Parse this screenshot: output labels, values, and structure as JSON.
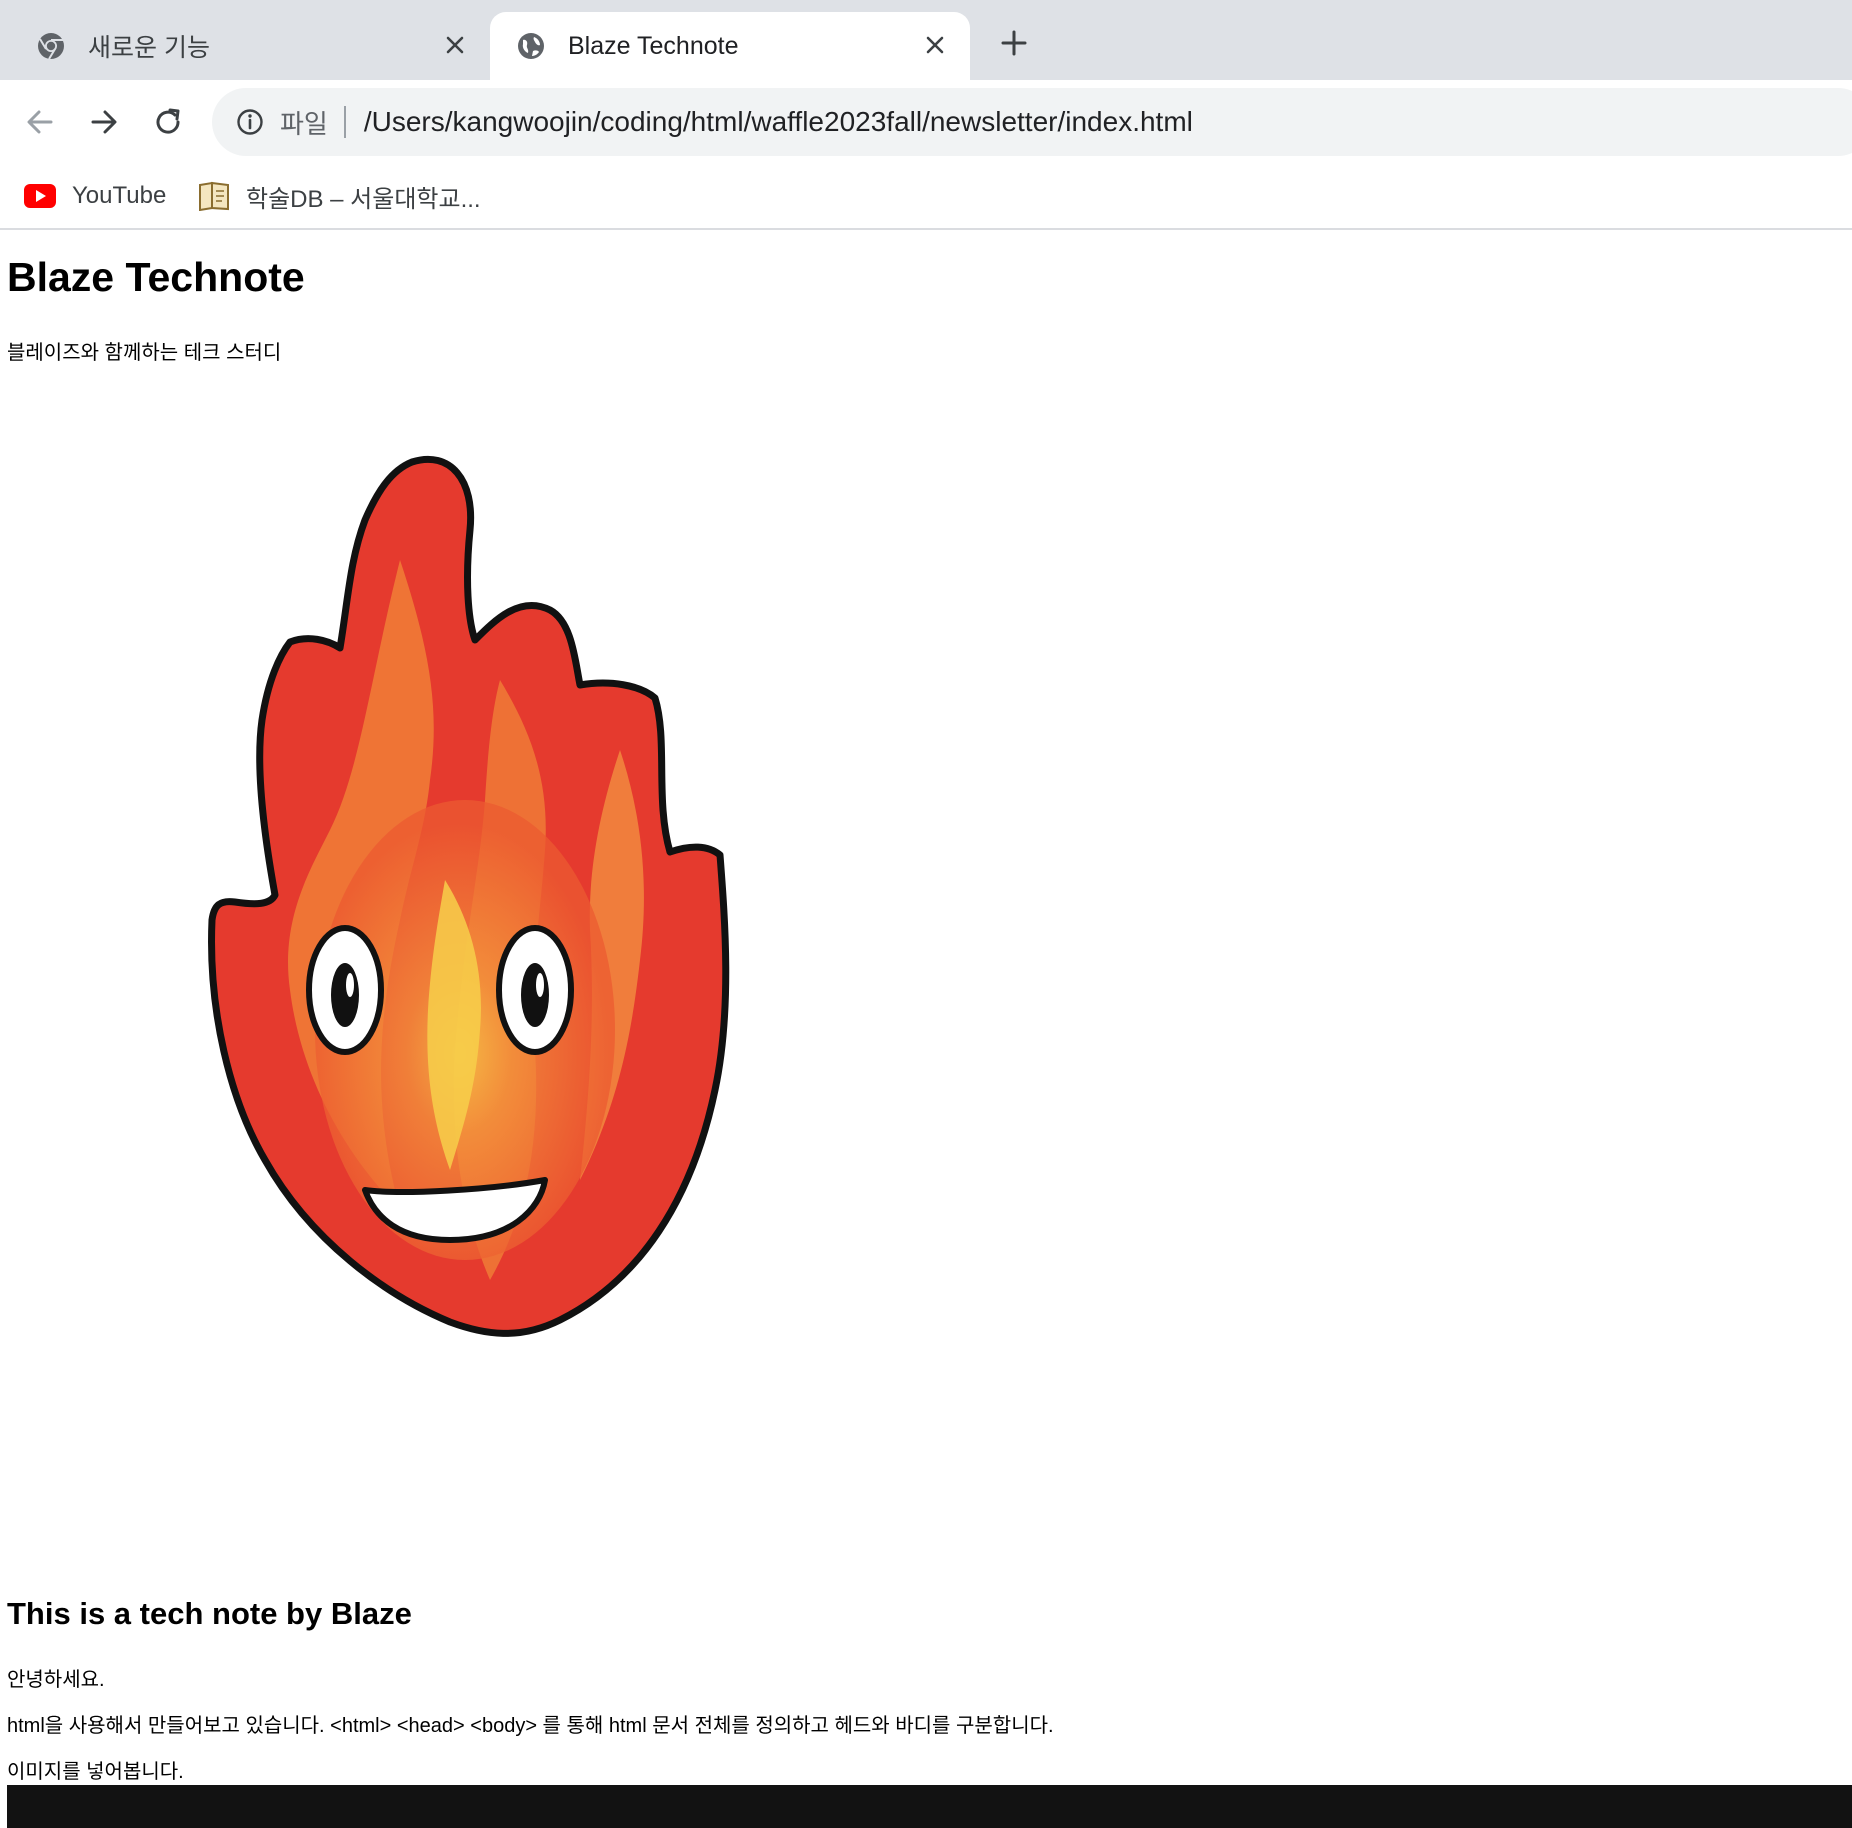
{
  "browser": {
    "tabs": [
      {
        "title": "새로운 기능",
        "icon": "chrome-icon",
        "active": false
      },
      {
        "title": "Blaze Technote",
        "icon": "globe-icon",
        "active": true
      }
    ],
    "address": {
      "scheme_label": "파일",
      "url": "/Users/kangwoojin/coding/html/waffle2023fall/newsletter/index.html"
    },
    "bookmarks": [
      {
        "label": "YouTube",
        "icon": "youtube-icon"
      },
      {
        "label": "학술DB – 서울대학교...",
        "icon": "book-icon"
      }
    ]
  },
  "page": {
    "title": "Blaze Technote",
    "subtitle": "블레이즈와 함께하는 테크 스터디",
    "image_subject": "flame-mascot",
    "heading2": "This is a tech note by Blaze",
    "paragraphs": [
      "안녕하세요.",
      "html을 사용해서 만들어보고 있습니다. <html> <head> <body> 를 통해 html 문서 전체를 정의하고 헤드와 바디를 구분합니다.",
      "이미지를 넣어봅니다."
    ]
  },
  "colors": {
    "tabstrip": "#dee1e6",
    "omnibox": "#f1f3f4",
    "flame_red": "#e53a2e",
    "flame_orange": "#f07b36",
    "flame_yellow": "#f7cf4a"
  }
}
